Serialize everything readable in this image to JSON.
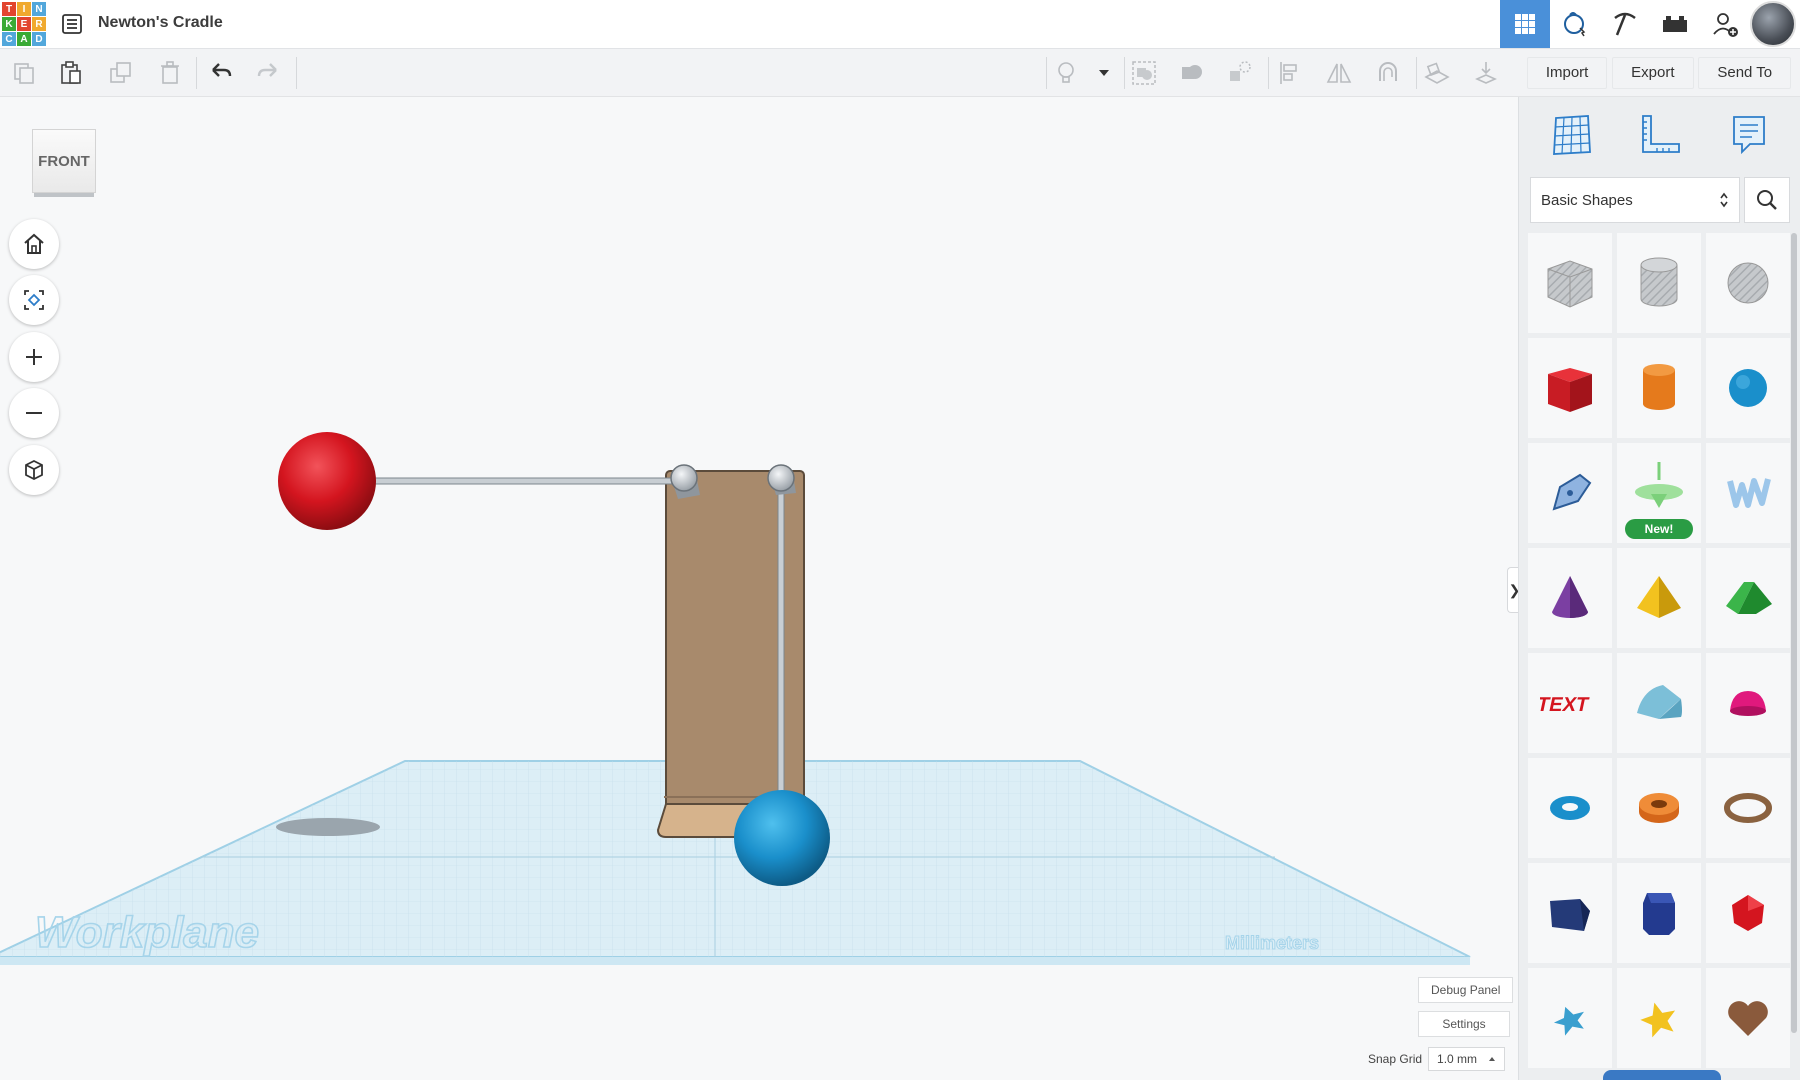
{
  "app": {
    "logo_letters": [
      "T",
      "I",
      "N",
      "K",
      "E",
      "R",
      "C",
      "A",
      "D"
    ],
    "title": "Newton's Cradle"
  },
  "top_nav": {
    "icons": [
      "3d-design-grid-icon",
      "hand-sim-icon",
      "pickaxe-icon",
      "bricks-icon",
      "add-user-icon",
      "avatar"
    ]
  },
  "toolbar": {
    "left_tools": [
      "copy-icon",
      "paste-icon",
      "duplicate-icon",
      "delete-icon",
      "undo-icon",
      "redo-icon"
    ],
    "right_tools": [
      "bulb-icon",
      "dropdown-caret-icon",
      "group-icon",
      "ungroup-icon",
      "solid-hole-icon",
      "align-icon",
      "mirror-icon",
      "cruise-icon",
      "workplane-icon",
      "drop-icon"
    ]
  },
  "actions": {
    "import": "Import",
    "export": "Export",
    "send_to": "Send To"
  },
  "viewcube": {
    "face": "FRONT"
  },
  "canvas": {
    "workplane_label": "Workplane",
    "units_label": "Millimeters",
    "debug_panel": "Debug Panel",
    "settings": "Settings",
    "snap_grid_label": "Snap Grid",
    "snap_grid_value": "1.0 mm"
  },
  "panel": {
    "category": "Basic Shapes",
    "new_badge": "New!",
    "shapes": [
      "box-hole",
      "cylinder-hole",
      "sphere-hole",
      "box",
      "cylinder",
      "sphere",
      "scribble",
      "spinner",
      "shape-generator-text",
      "cone",
      "pyramid",
      "roof",
      "text",
      "half-cylinder",
      "paraboloid",
      "torus",
      "tube",
      "ring",
      "wedge",
      "polygon",
      "icosahedron",
      "star-flat",
      "star",
      "heart"
    ]
  },
  "colors": {
    "accent": "#4a90d9",
    "red_ball": "#d4151f",
    "blue_ball": "#1a8fcb",
    "stand": "#a88a6c",
    "workplane": "#d9ecf5"
  }
}
